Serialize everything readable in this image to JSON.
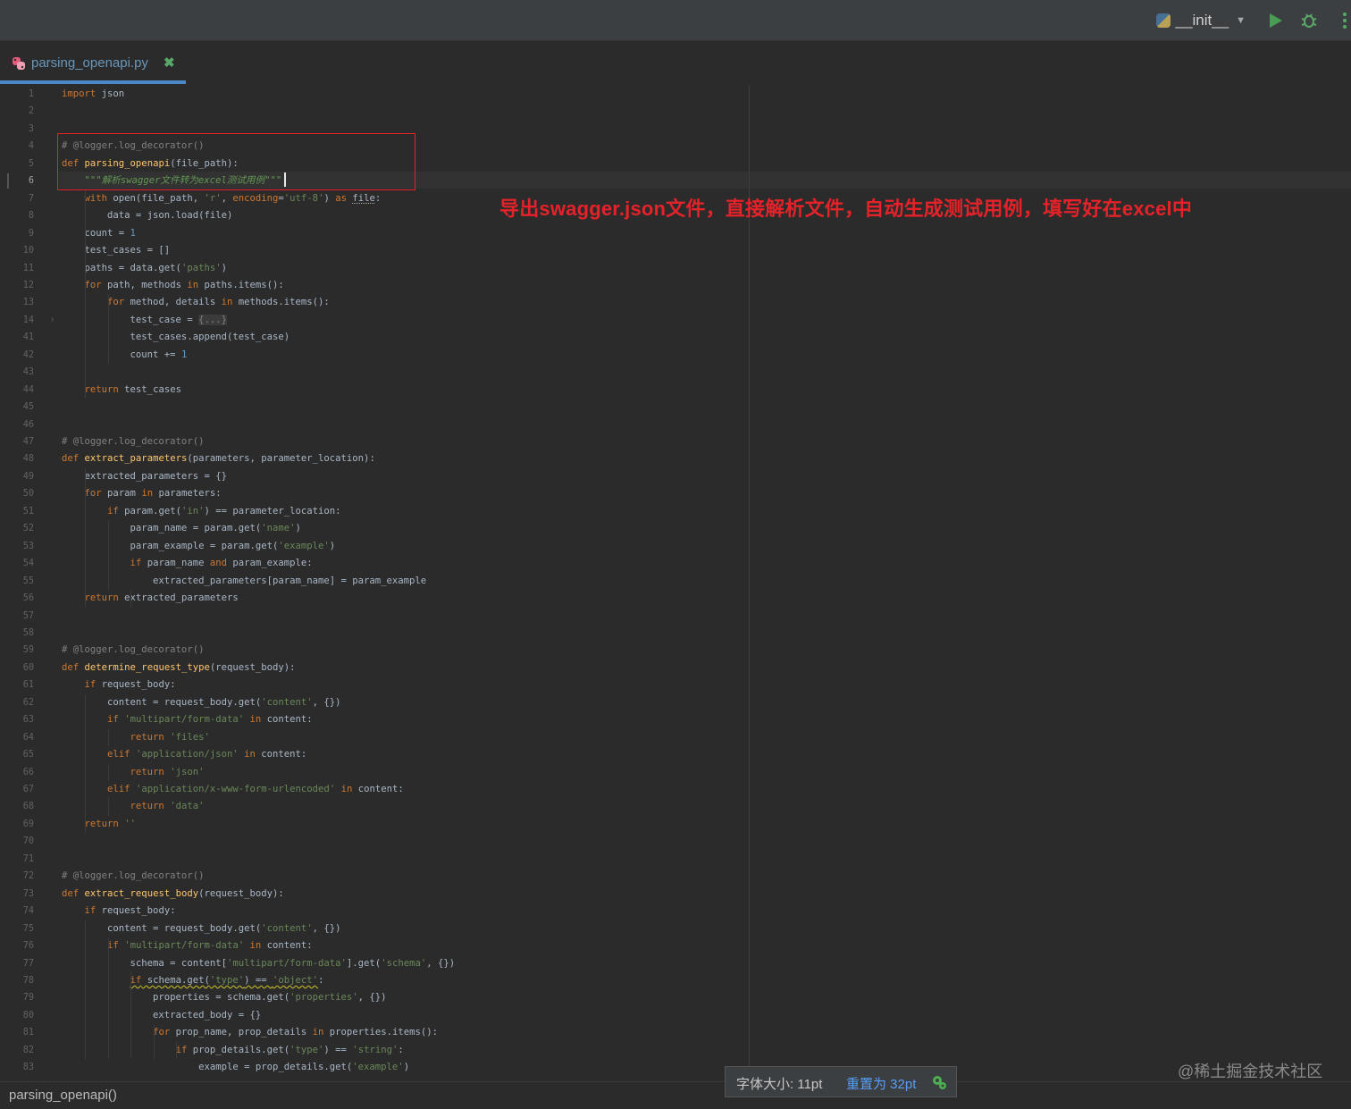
{
  "toolbar": {
    "run_config": "__init__",
    "icons": [
      "python-icon",
      "chevron-down-icon",
      "run-icon",
      "debug-icon",
      "more-icon"
    ]
  },
  "tab": {
    "filename": "parsing_openapi.py",
    "close_glyph": "✖"
  },
  "colors": {
    "keyword": "#cc7832",
    "function": "#ffc66d",
    "string": "#6a8759",
    "number": "#6897bb",
    "comment": "#808080",
    "highlight_box": "#e5222a",
    "annotation": "#e52229"
  },
  "code_lines": [
    {
      "n": "1",
      "html": "<span class=\"kw\">import</span> json"
    },
    {
      "n": "2",
      "html": ""
    },
    {
      "n": "3",
      "html": ""
    },
    {
      "n": "4",
      "html": "<span class=\"cmt\"># @logger.log_decorator()</span>"
    },
    {
      "n": "5",
      "html": "<span class=\"kw\">def</span> <span class=\"fn\">parsing_openapi</span>(file_path):"
    },
    {
      "n": "6",
      "html": "    <span class=\"doc\">\"\"\"解析swagger文件转为excel测试用例\"\"\"</span>"
    },
    {
      "n": "7",
      "html": "    <span class=\"kw\">with</span> open(file_path, <span class=\"str\">'r'</span>, <span class=\"kw\">encoding</span>=<span class=\"str\">'utf-8'</span>) <span class=\"kw\">as</span> <span class=\"undl\">file</span>:"
    },
    {
      "n": "8",
      "html": "        data = json.load(file)"
    },
    {
      "n": "9",
      "html": "    count = <span class=\"num\">1</span>"
    },
    {
      "n": "10",
      "html": "    test_cases = []"
    },
    {
      "n": "11",
      "html": "    paths = data.get(<span class=\"str\">'paths'</span>)"
    },
    {
      "n": "12",
      "html": "    <span class=\"kw\">for</span> path, methods <span class=\"kw\">in</span> paths.items():"
    },
    {
      "n": "13",
      "html": "        <span class=\"kw\">for</span> method, details <span class=\"kw\">in</span> methods.items():"
    },
    {
      "n": "14",
      "html": "            test_case = <span class=\"fold\">{...}</span>"
    },
    {
      "n": "41",
      "html": "            test_cases.append(test_case)"
    },
    {
      "n": "42",
      "html": "            count += <span class=\"num\">1</span>"
    },
    {
      "n": "43",
      "html": ""
    },
    {
      "n": "44",
      "html": "    <span class=\"kw\">return</span> test_cases"
    },
    {
      "n": "45",
      "html": ""
    },
    {
      "n": "46",
      "html": ""
    },
    {
      "n": "47",
      "html": "<span class=\"cmt\"># @logger.log_decorator()</span>"
    },
    {
      "n": "48",
      "html": "<span class=\"kw\">def</span> <span class=\"fn\">extract_parameters</span>(parameters, parameter_location):"
    },
    {
      "n": "49",
      "html": "    extracted_parameters = {}"
    },
    {
      "n": "50",
      "html": "    <span class=\"kw\">for</span> param <span class=\"kw\">in</span> parameters:"
    },
    {
      "n": "51",
      "html": "        <span class=\"kw\">if</span> param.get(<span class=\"str\">'in'</span>) == parameter_location:"
    },
    {
      "n": "52",
      "html": "            param_name = param.get(<span class=\"str\">'name'</span>)"
    },
    {
      "n": "53",
      "html": "            param_example = param.get(<span class=\"str\">'example'</span>)"
    },
    {
      "n": "54",
      "html": "            <span class=\"kw\">if</span> param_name <span class=\"kw\">and</span> param_example:"
    },
    {
      "n": "55",
      "html": "                extracted_parameters[param_name] = param_example"
    },
    {
      "n": "56",
      "html": "    <span class=\"kw\">return</span> extracted_parameters"
    },
    {
      "n": "57",
      "html": ""
    },
    {
      "n": "58",
      "html": ""
    },
    {
      "n": "59",
      "html": "<span class=\"cmt\"># @logger.log_decorator()</span>"
    },
    {
      "n": "60",
      "html": "<span class=\"kw\">def</span> <span class=\"fn\">determine_request_type</span>(request_body):"
    },
    {
      "n": "61",
      "html": "    <span class=\"kw\">if</span> request_body:"
    },
    {
      "n": "62",
      "html": "        content = request_body.get(<span class=\"str\">'content'</span>, {})"
    },
    {
      "n": "63",
      "html": "        <span class=\"kw\">if</span> <span class=\"str\">'multipart/form-data'</span> <span class=\"kw\">in</span> content:"
    },
    {
      "n": "64",
      "html": "            <span class=\"kw\">return</span> <span class=\"str\">'files'</span>"
    },
    {
      "n": "65",
      "html": "        <span class=\"kw\">elif</span> <span class=\"str\">'application/json'</span> <span class=\"kw\">in</span> content:"
    },
    {
      "n": "66",
      "html": "            <span class=\"kw\">return</span> <span class=\"str\">'json'</span>"
    },
    {
      "n": "67",
      "html": "        <span class=\"kw\">elif</span> <span class=\"str\">'application/x-www-form-urlencoded'</span> <span class=\"kw\">in</span> content:"
    },
    {
      "n": "68",
      "html": "            <span class=\"kw\">return</span> <span class=\"str\">'data'</span>"
    },
    {
      "n": "69",
      "html": "    <span class=\"kw\">return</span> <span class=\"str\">''</span>"
    },
    {
      "n": "70",
      "html": ""
    },
    {
      "n": "71",
      "html": ""
    },
    {
      "n": "72",
      "html": "<span class=\"cmt\"># @logger.log_decorator()</span>"
    },
    {
      "n": "73",
      "html": "<span class=\"kw\">def</span> <span class=\"fn\">extract_request_body</span>(request_body):"
    },
    {
      "n": "74",
      "html": "    <span class=\"kw\">if</span> request_body:"
    },
    {
      "n": "75",
      "html": "        content = request_body.get(<span class=\"str\">'content'</span>, {})"
    },
    {
      "n": "76",
      "html": "        <span class=\"kw\">if</span> <span class=\"str\">'multipart/form-data'</span> <span class=\"kw\">in</span> content:"
    },
    {
      "n": "77",
      "html": "            schema = content[<span class=\"str\">'multipart/form-data'</span>].get(<span class=\"str\">'schema'</span>, {})"
    },
    {
      "n": "78",
      "html": "            <span class=\"warn\"><span class=\"kw\">if</span> schema.get(<span class=\"str\">'type'</span>) == <span class=\"str\">'object'</span></span>:"
    },
    {
      "n": "79",
      "html": "                properties = schema.get(<span class=\"str\">'properties'</span>, {})"
    },
    {
      "n": "80",
      "html": "                extracted_body = {}"
    },
    {
      "n": "81",
      "html": "                <span class=\"kw\">for</span> prop_name, prop_details <span class=\"kw\">in</span> properties.items():"
    },
    {
      "n": "82",
      "html": "                    <span class=\"kw\">if</span> prop_details.get(<span class=\"str\">'type'</span>) == <span class=\"str\">'string'</span>:"
    },
    {
      "n": "83",
      "html": "                        example = prop_details.get(<span class=\"str\">'example'</span>)"
    }
  ],
  "annotation": "导出swagger.json文件，直接解析文件，自动生成测试用例，填写好在excel中",
  "status": {
    "breadcrumb": "parsing_openapi()",
    "zoom_label": "字体大小: 11pt",
    "zoom_reset": "重置为 32pt"
  },
  "watermark": "@稀土掘金技术社区"
}
